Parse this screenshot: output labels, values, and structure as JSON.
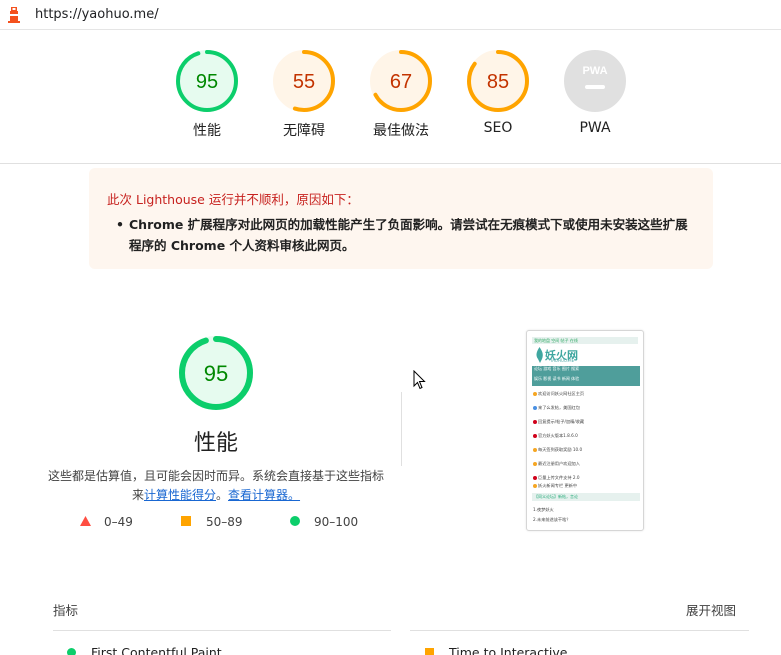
{
  "browser": {
    "url": "https://yaohuo.me/",
    "icon": "lighthouse-icon"
  },
  "gauges": [
    {
      "score": "95",
      "label": "性能",
      "color": "#0cce6b",
      "bg": "#e6fbef",
      "text": "#008800",
      "fraction": 0.95
    },
    {
      "score": "55",
      "label": "无障碍",
      "color": "#ffa400",
      "bg": "#fff5e8",
      "text": "#c33300",
      "fraction": 0.55
    },
    {
      "score": "67",
      "label": "最佳做法",
      "color": "#ffa400",
      "bg": "#fff5e8",
      "text": "#c33300",
      "fraction": 0.67
    },
    {
      "score": "85",
      "label": "SEO",
      "color": "#ffa400",
      "bg": "#fff5e8",
      "text": "#c33300",
      "fraction": 0.85
    },
    {
      "score": "PWA",
      "label": "PWA",
      "color": "#cccccc",
      "bg": "#e0e0e0",
      "text": "#ffffff",
      "fraction": 0
    }
  ],
  "warning": {
    "title": "此次 Lighthouse 运行并不顺利，原因如下：",
    "items": [
      "Chrome 扩展程序对此网页的加载性能产生了负面影响。请尝试在无痕模式下或使用未安装这些扩展程序的 Chrome 个人资料审核此网页。"
    ]
  },
  "performance": {
    "score": "95",
    "title": "性能",
    "desc_prefix": "这些都是估算值，且可能会因时而异。系统会直接基于这些指标来",
    "link1": "计算性能得分",
    "desc_mid": "。",
    "link2": "查看计算器。",
    "legend": [
      {
        "range": "0–49",
        "color": "#ff4e42",
        "shape": "triangle"
      },
      {
        "range": "50–89",
        "color": "#ffa400",
        "shape": "square"
      },
      {
        "range": "90–100",
        "color": "#0cce6b",
        "shape": "circle"
      }
    ]
  },
  "thumbnail": {
    "nav": "我的地盘 空间 帖子 在线",
    "logo": "妖火网",
    "logo_sub": "YAOHUO.ME",
    "bar1": "论坛 游戏 音乐 图片 搜索",
    "bar2": "娱乐 影视 读书 新闻 体验",
    "lines": [
      {
        "text": "欢迎访问妖火网社区主页",
        "color": "#f5a623"
      },
      {
        "text": "来了么发帖，美国红包",
        "color": "#4a90e2"
      },
      {
        "text": "回复提示/帖子/加精/收藏",
        "color": "#d0021b"
      },
      {
        "text": "官方妖火版本1.8.6.0",
        "color": "#d0021b"
      },
      {
        "text": "每天签到获取奖励 10.0",
        "color": "#f5a623"
      },
      {
        "text": "最近注册用户欢迎加入",
        "color": "#f5a623"
      },
      {
        "text": "巨量上传文件支持 2.0",
        "color": "#d0021b"
      },
      {
        "text": "妖火新闻专栏 更新中",
        "color": "#f5a623"
      }
    ],
    "box": "【同义论坛】新帖，言论",
    "foot1": "1.夜梦妖火",
    "foot2": "2.未来前途该干啥？"
  },
  "metrics": {
    "header": "指标",
    "expand": "展开视图",
    "items": [
      {
        "name": "First Contentful Paint",
        "color": "#0cce6b",
        "shape": "circle"
      },
      {
        "name": "Time to Interactive",
        "color": "#ffa400",
        "shape": "square"
      }
    ]
  }
}
